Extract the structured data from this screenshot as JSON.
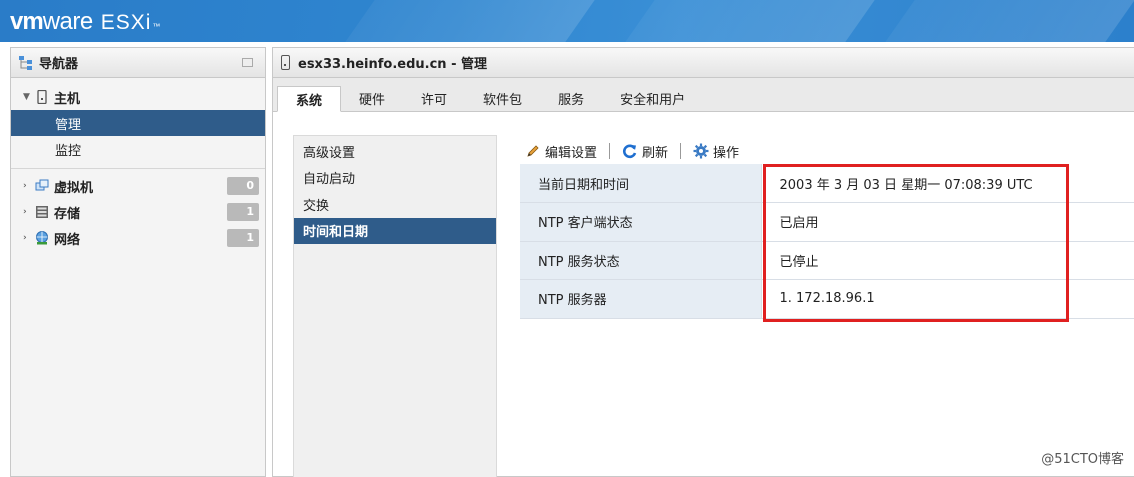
{
  "app": {
    "logo_vm": "vm",
    "logo_ware": "ware",
    "logo_product": "ESXi",
    "logo_tm": "™"
  },
  "navigator": {
    "title": "导航器",
    "host_label": "主机",
    "host_children": [
      {
        "label": "管理",
        "active": true
      },
      {
        "label": "监控",
        "active": false
      }
    ],
    "objects": [
      {
        "label": "虚拟机",
        "count": "0",
        "icon": "vm-icon"
      },
      {
        "label": "存储",
        "count": "1",
        "icon": "storage-icon"
      },
      {
        "label": "网络",
        "count": "1",
        "icon": "network-icon"
      }
    ]
  },
  "main": {
    "title": "esx33.heinfo.edu.cn - 管理",
    "tabs": [
      {
        "label": "系统",
        "active": true
      },
      {
        "label": "硬件",
        "active": false
      },
      {
        "label": "许可",
        "active": false
      },
      {
        "label": "软件包",
        "active": false
      },
      {
        "label": "服务",
        "active": false
      },
      {
        "label": "安全和用户",
        "active": false
      }
    ],
    "subnav": [
      {
        "label": "高级设置",
        "active": false
      },
      {
        "label": "自动启动",
        "active": false
      },
      {
        "label": "交换",
        "active": false
      },
      {
        "label": "时间和日期",
        "active": true
      }
    ],
    "toolbar": {
      "edit_label": "编辑设置",
      "refresh_label": "刷新",
      "actions_label": "操作"
    },
    "properties": [
      {
        "key": "当前日期和时间",
        "value": "2003 年 3 月 03 日 星期一 07:08:39 UTC"
      },
      {
        "key": "NTP 客户端状态",
        "value": "已启用"
      },
      {
        "key": "NTP 服务状态",
        "value": "已停止"
      },
      {
        "key": "NTP 服务器",
        "value": "1. 172.18.96.1"
      }
    ]
  },
  "colors": {
    "header_blue": "#2f86d0",
    "selected_bg": "#2f5c8a",
    "highlight_red": "#e02020"
  },
  "watermark": "@51CTO博客"
}
